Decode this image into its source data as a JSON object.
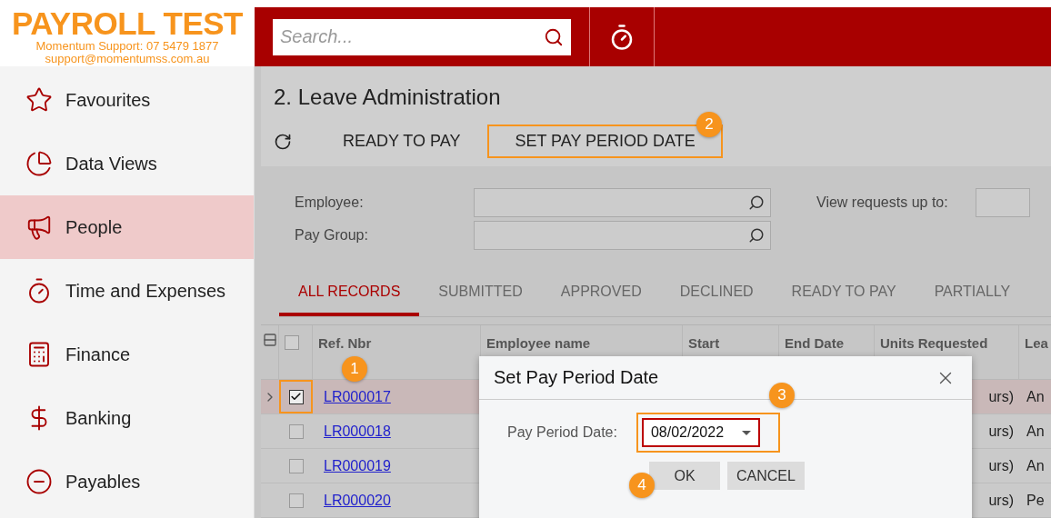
{
  "logo": {
    "title": "PAYROLL TEST",
    "line_1": "Momentum Support: 07 5479 1877",
    "line_2": "support@momentumss.com.au"
  },
  "search": {
    "placeholder": "Search..."
  },
  "sidebar": {
    "items": [
      {
        "label": "Favourites",
        "selected": false
      },
      {
        "label": "Data Views",
        "selected": false
      },
      {
        "label": "People",
        "selected": true
      },
      {
        "label": "Time and Expenses",
        "selected": false
      },
      {
        "label": "Finance",
        "selected": false
      },
      {
        "label": "Banking",
        "selected": false
      },
      {
        "label": "Payables",
        "selected": false
      }
    ]
  },
  "page": {
    "title": "2. Leave Administration",
    "toolbar": [
      {
        "kind": "icon"
      },
      {
        "kind": "text",
        "label": "READY TO PAY",
        "highlighted": false
      },
      {
        "kind": "text",
        "label": "SET PAY PERIOD DATE",
        "highlighted": true
      }
    ]
  },
  "filters": [
    {
      "label": "Employee:"
    },
    {
      "label": "Pay Group:"
    }
  ],
  "side_filter": {
    "label": "View requests up to:"
  },
  "tabs": [
    {
      "label": "ALL RECORDS",
      "selected": true
    },
    {
      "label": "SUBMITTED",
      "selected": false
    },
    {
      "label": "APPROVED",
      "selected": false
    },
    {
      "label": "DECLINED",
      "selected": false
    },
    {
      "label": "READY TO PAY",
      "selected": false
    },
    {
      "label": "PARTIALLY",
      "selected": false
    }
  ],
  "table": {
    "select_all_checked": false,
    "columns": [
      "Ref. Nbr",
      "Employee name",
      "Start",
      "End Date",
      "Units Requested",
      "Lea"
    ],
    "rows": [
      {
        "ref": "LR000017",
        "checked": true,
        "selected": true,
        "units": "urs)",
        "column_6": "An"
      },
      {
        "ref": "LR000018",
        "checked": false,
        "selected": false,
        "units": "urs)",
        "column_6": "An"
      },
      {
        "ref": "LR000019",
        "checked": false,
        "selected": false,
        "units": "urs)",
        "column_6": "An"
      },
      {
        "ref": "LR000020",
        "checked": false,
        "selected": false,
        "units": "urs)",
        "column_6": "Pe"
      }
    ]
  },
  "dialog": {
    "title": "Set Pay Period Date",
    "label": "Pay Period Date:",
    "value": "08/02/2022",
    "buttons": [
      "OK",
      "CANCEL"
    ]
  },
  "callouts": [
    "1",
    "2",
    "3",
    "4"
  ]
}
